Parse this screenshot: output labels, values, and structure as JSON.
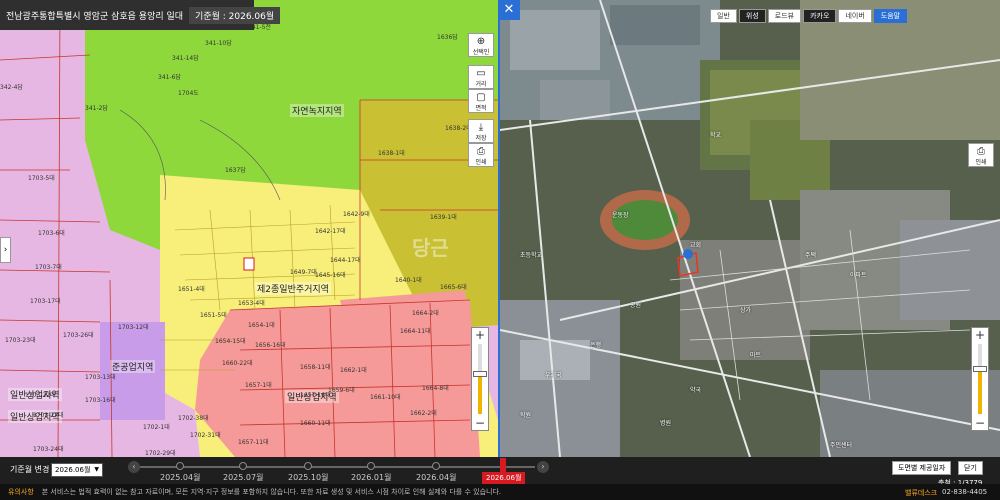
{
  "header": {
    "title": "전남광주통합특별시 영암군 삼호읍 용앙리 일대",
    "base_month": "기준월 : 2026.06월"
  },
  "left_tools": [
    {
      "name": "select-tool",
      "icon": "⊕",
      "label": "선택인"
    },
    {
      "name": "distance-tool",
      "icon": "▭",
      "label": "거리"
    },
    {
      "name": "area-tool",
      "icon": "▢",
      "label": "면적"
    },
    {
      "name": "save-tool",
      "icon": "⤓",
      "label": "저장"
    },
    {
      "name": "print-tool",
      "icon": "⎙",
      "label": "인쇄"
    }
  ],
  "zones": {
    "green": "자연녹지지역",
    "yellow": "제2종일반주거지역",
    "red": "일반상업지역",
    "purple": "준공업지역"
  },
  "colors": {
    "purple": "#e6b7e2",
    "green": "#8ed83c",
    "olive": "#c9c033",
    "yellow": "#f7ef7a",
    "red": "#f59a98",
    "violet": "#c89ce8",
    "accent": "#2a6fd6",
    "timeline_active": "#d71920"
  },
  "parcels": [
    "341-4전",
    "341-5전",
    "341-10답",
    "341-14답",
    "341-6답",
    "341-2답",
    "342-4답",
    "1704도",
    "1636답",
    "1637답",
    "1638-2대",
    "1638-1대",
    "1639-1대",
    "1642-9대",
    "1642-17대",
    "1644-17대",
    "1649-7대",
    "1645-16대",
    "1640-1대",
    "1665-6대",
    "1651-4대",
    "1653-4대",
    "1651-5대",
    "1654-1대",
    "1654-15대",
    "1656-16대",
    "1664-2대",
    "1664-11대",
    "1660-22대",
    "1658-11대",
    "1662-1대",
    "1657-1대",
    "1657-16대",
    "1661-10대",
    "1664-8대",
    "1659-6대",
    "1662-2대",
    "1702-1대",
    "1702-38대",
    "1702-31대",
    "1702-29대",
    "1657-11대",
    "1660-11대",
    "1703-5대",
    "1703-6대",
    "1703-7대",
    "1703-17대",
    "1703-12대",
    "1703-26대",
    "1703-13대",
    "1703-16대",
    "1703-22대",
    "1703-27대",
    "1703-24대",
    "1703-23대"
  ],
  "right_map": {
    "map_types": [
      "일반",
      "위성",
      "로드뷰",
      "카카오",
      "네이버",
      "도움말"
    ],
    "print_label": "인쇄",
    "pois": [
      "학교",
      "운동장",
      "교회",
      "초등학교",
      "주택",
      "상가",
      "공원",
      "아파트",
      "은행",
      "마트",
      "약국",
      "학원",
      "병원",
      "주민센터",
      "우체국"
    ]
  },
  "timeline": {
    "label": "기준월 변경",
    "select_value": "2026.06월",
    "dates": [
      "2025.04월",
      "2025.07월",
      "2025.10월",
      "2026.01월",
      "2026.04월"
    ],
    "current": "2026.06월",
    "btn_map": "도면별 제공일자",
    "btn_close": "닫기",
    "scale": "축척 : 1/3779"
  },
  "notice": {
    "warn": "유의사항",
    "message": "본 서비스는 법적 효력이 없는 참고 자료이며, 모든 지역·지구 정보를 포함하지 않습니다. 또한 자료 생성 및 서비스 시점 차이로 인해 실제와 다를 수 있습니다.",
    "brand": "밸류데스크",
    "phone": "02-838-4405"
  },
  "watermark": "당근"
}
